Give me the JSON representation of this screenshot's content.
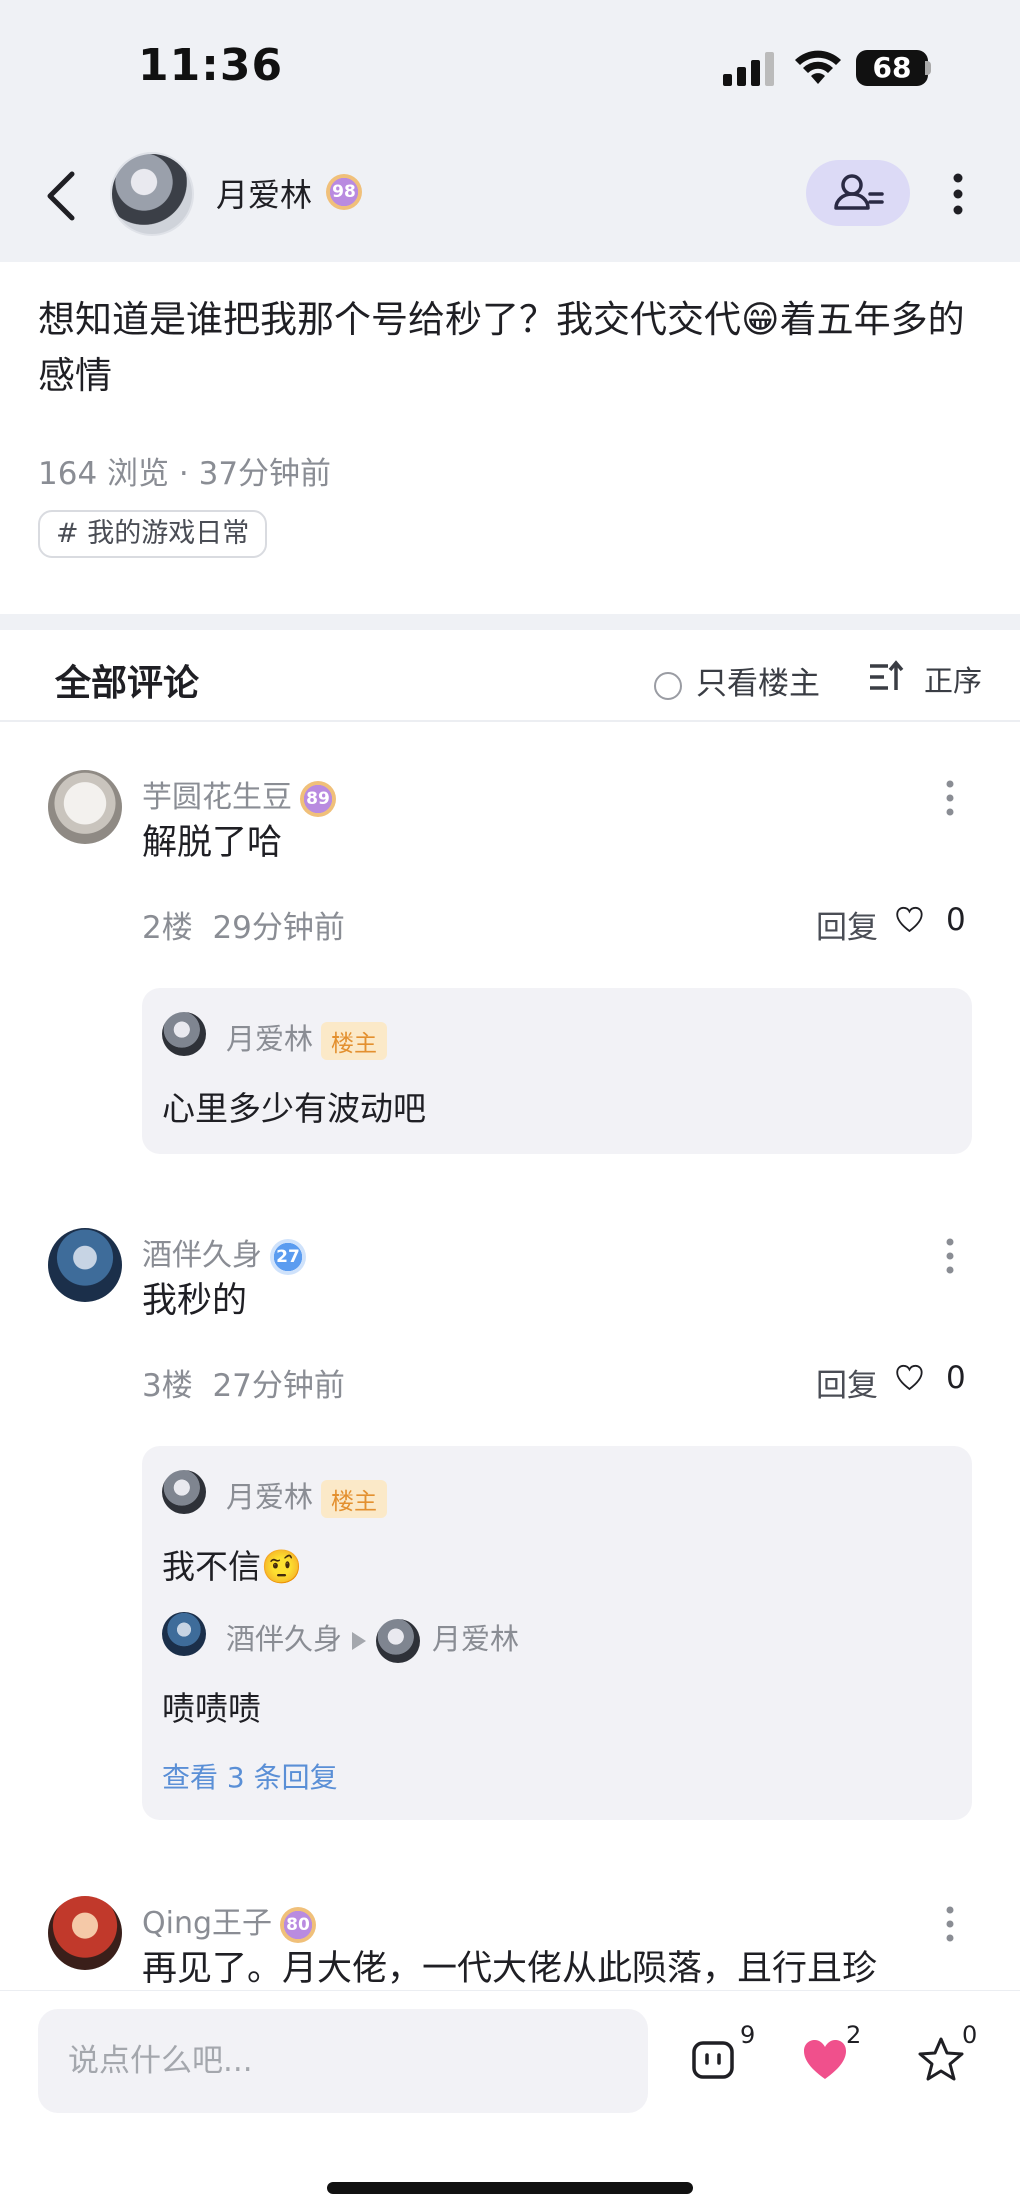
{
  "status_bar": {
    "time": "11:36",
    "battery": "68"
  },
  "nav": {
    "user_name": "月爱林",
    "level": "98"
  },
  "post": {
    "text": "想知道是谁把我那个号给秒了？我交代交代😁着五年多的感情",
    "views": "164 浏览",
    "time_ago": "37分钟前",
    "tag": "# 我的游戏日常"
  },
  "comments_header": {
    "title": "全部评论",
    "only_owner": "只看楼主",
    "sort": "正序"
  },
  "comments": [
    {
      "user": "芋圆花生豆",
      "level": "89",
      "text": "解脱了哈",
      "floor": "2楼",
      "time": "29分钟前",
      "reply_label": "回复",
      "likes": "0",
      "replies": [
        {
          "user": "月爱林",
          "owner_tag": "楼主",
          "text": "心里多少有波动吧"
        }
      ]
    },
    {
      "user": "酒伴久身",
      "level": "27",
      "text": "我秒的",
      "floor": "3楼",
      "time": "27分钟前",
      "reply_label": "回复",
      "likes": "0",
      "replies": [
        {
          "user": "月爱林",
          "owner_tag": "楼主",
          "text": "我不信🤨"
        },
        {
          "user": "酒伴久身",
          "reply_to": "月爱林",
          "text": "啧啧啧"
        }
      ],
      "view_more": "查看 3 条回复"
    },
    {
      "user": "Qing王子",
      "level": "80",
      "text": "再见了。月大佬，一代大佬从此陨落，且行且珍"
    }
  ],
  "bottom_bar": {
    "placeholder": "说点什么吧...",
    "comment_count": "9",
    "like_count": "2",
    "fav_count": "0"
  },
  "colors": {
    "accent_like": "#f0508c",
    "link": "#5a8fd6",
    "owner_tag_bg": "#fbe9c8",
    "owner_tag_text": "#e3902f",
    "follow_bg": "#dcdaf6"
  }
}
